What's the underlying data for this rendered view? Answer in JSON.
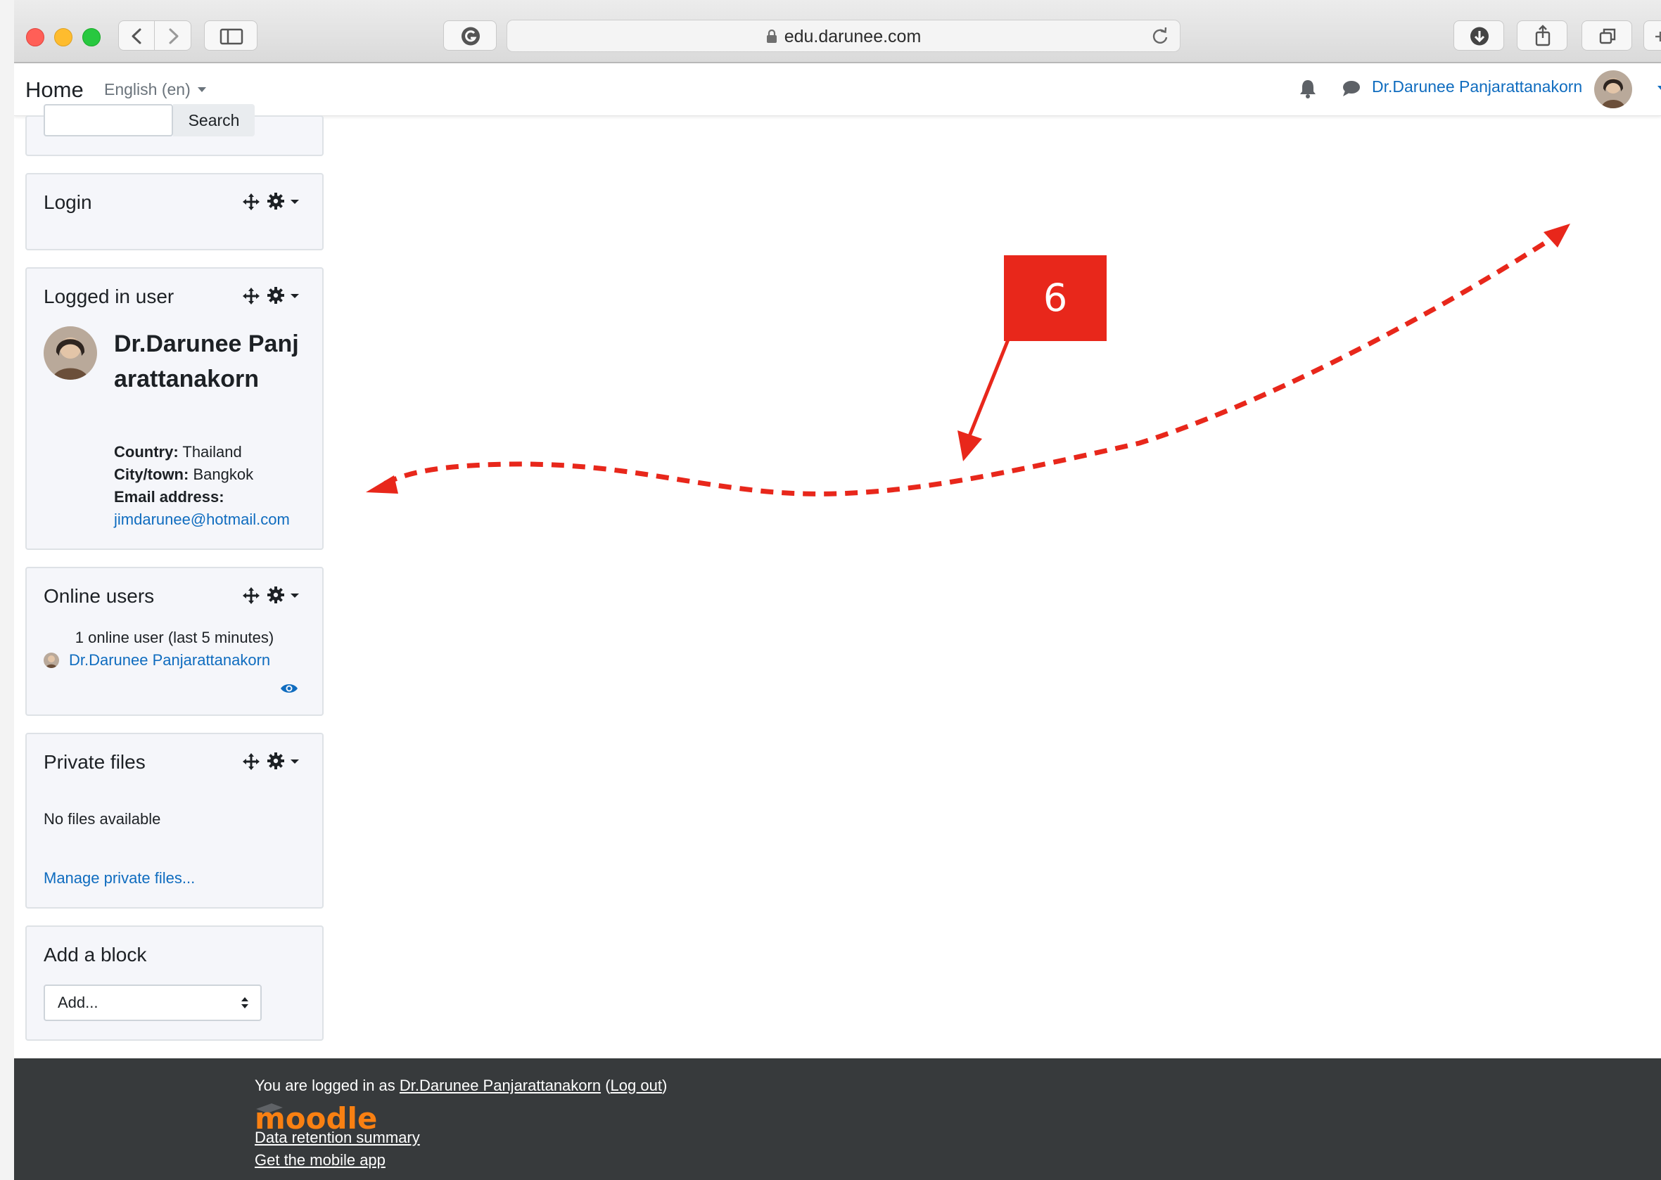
{
  "browser": {
    "url": "edu.darunee.com"
  },
  "navbar": {
    "brand": "Home",
    "language": "English (en)",
    "user_name": "Dr.Darunee Panjarattanakorn"
  },
  "blocks": {
    "search": {
      "button_label": "Search"
    },
    "login": {
      "title": "Login"
    },
    "logged_in_user": {
      "title": "Logged in user",
      "name": "Dr.Darunee Panjarattanakorn",
      "country_label": "Country:",
      "country_value": "Thailand",
      "city_label": "City/town:",
      "city_value": "Bangkok",
      "email_label": "Email address:",
      "email_value": "jimdarunee@hotmail.com"
    },
    "online_users": {
      "title": "Online users",
      "summary": "1 online user (last 5 minutes)",
      "user": "Dr.Darunee Panjarattanakorn"
    },
    "private_files": {
      "title": "Private files",
      "empty_text": "No files available",
      "manage_link": "Manage private files..."
    },
    "add_block": {
      "title": "Add a block",
      "select_value": "Add..."
    }
  },
  "annotation": {
    "step_number": "6",
    "color": "#e8271b"
  },
  "footer": {
    "logged_in_prefix": "You are logged in as",
    "user_link": "Dr.Darunee Panjarattanakorn",
    "paren_open": "(",
    "logout_link": "Log out",
    "paren_close": ")",
    "logo_text": "moodle",
    "data_retention": "Data retention summary",
    "mobile_app": "Get the mobile app"
  },
  "colors": {
    "link": "#0f6cbf",
    "footer_bg": "#373a3c",
    "moodle_orange": "#f98012",
    "block_bg": "#f5f6fa"
  }
}
